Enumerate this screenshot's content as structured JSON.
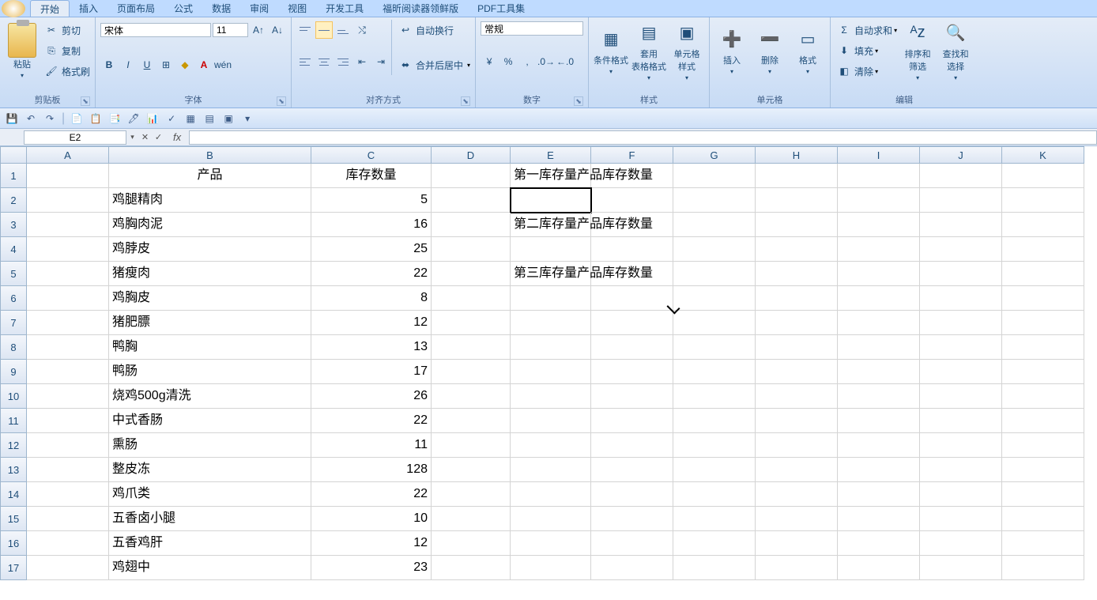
{
  "tabs": [
    "开始",
    "插入",
    "页面布局",
    "公式",
    "数据",
    "审阅",
    "视图",
    "开发工具",
    "福昕阅读器领鲜版",
    "PDF工具集"
  ],
  "activeTab": 0,
  "ribbon": {
    "clipboard": {
      "paste": "粘贴",
      "cut": "剪切",
      "copy": "复制",
      "painter": "格式刷",
      "label": "剪贴板"
    },
    "font": {
      "name": "宋体",
      "size": "11",
      "label": "字体"
    },
    "align": {
      "wrap": "自动换行",
      "merge": "合并后居中",
      "label": "对齐方式"
    },
    "number": {
      "format": "常规",
      "label": "数字"
    },
    "styles": {
      "cond": "条件格式",
      "table": "套用\n表格格式",
      "cell": "单元格\n样式",
      "label": "样式"
    },
    "cells": {
      "insert": "插入",
      "delete": "删除",
      "format": "格式",
      "label": "单元格"
    },
    "editing": {
      "sum": "自动求和",
      "fill": "填充",
      "clear": "清除",
      "sort": "排序和\n筛选",
      "find": "查找和\n选择",
      "label": "编辑"
    }
  },
  "namebox": "E2",
  "columns": [
    "A",
    "B",
    "C",
    "D",
    "E",
    "F",
    "G",
    "H",
    "I",
    "J",
    "K"
  ],
  "rows": [
    "1",
    "2",
    "3",
    "4",
    "5",
    "6",
    "7",
    "8",
    "9",
    "10",
    "11",
    "12",
    "13",
    "14",
    "15",
    "16",
    "17"
  ],
  "headers": {
    "B1": "产品",
    "C1": "库存数量"
  },
  "labels": {
    "E1": "第一库存量产品库存数量",
    "E3": "第二库存量产品库存数量",
    "E5": "第三库存量产品库存数量"
  },
  "data": [
    {
      "p": "鸡腿精肉",
      "q": "5"
    },
    {
      "p": "鸡胸肉泥",
      "q": "16"
    },
    {
      "p": "鸡脖皮",
      "q": "25"
    },
    {
      "p": "猪瘦肉",
      "q": "22"
    },
    {
      "p": "鸡胸皮",
      "q": "8"
    },
    {
      "p": "猪肥膘",
      "q": "12"
    },
    {
      "p": "鸭胸",
      "q": "13"
    },
    {
      "p": "鸭肠",
      "q": "17"
    },
    {
      "p": "烧鸡500g清洗",
      "q": "26"
    },
    {
      "p": "中式香肠",
      "q": "22"
    },
    {
      "p": "熏肠",
      "q": "11"
    },
    {
      "p": "整皮冻",
      "q": "128"
    },
    {
      "p": "鸡爪类",
      "q": "22"
    },
    {
      "p": "五香卤小腿",
      "q": "10"
    },
    {
      "p": "五香鸡肝",
      "q": "12"
    },
    {
      "p": "鸡翅中",
      "q": "23"
    }
  ]
}
